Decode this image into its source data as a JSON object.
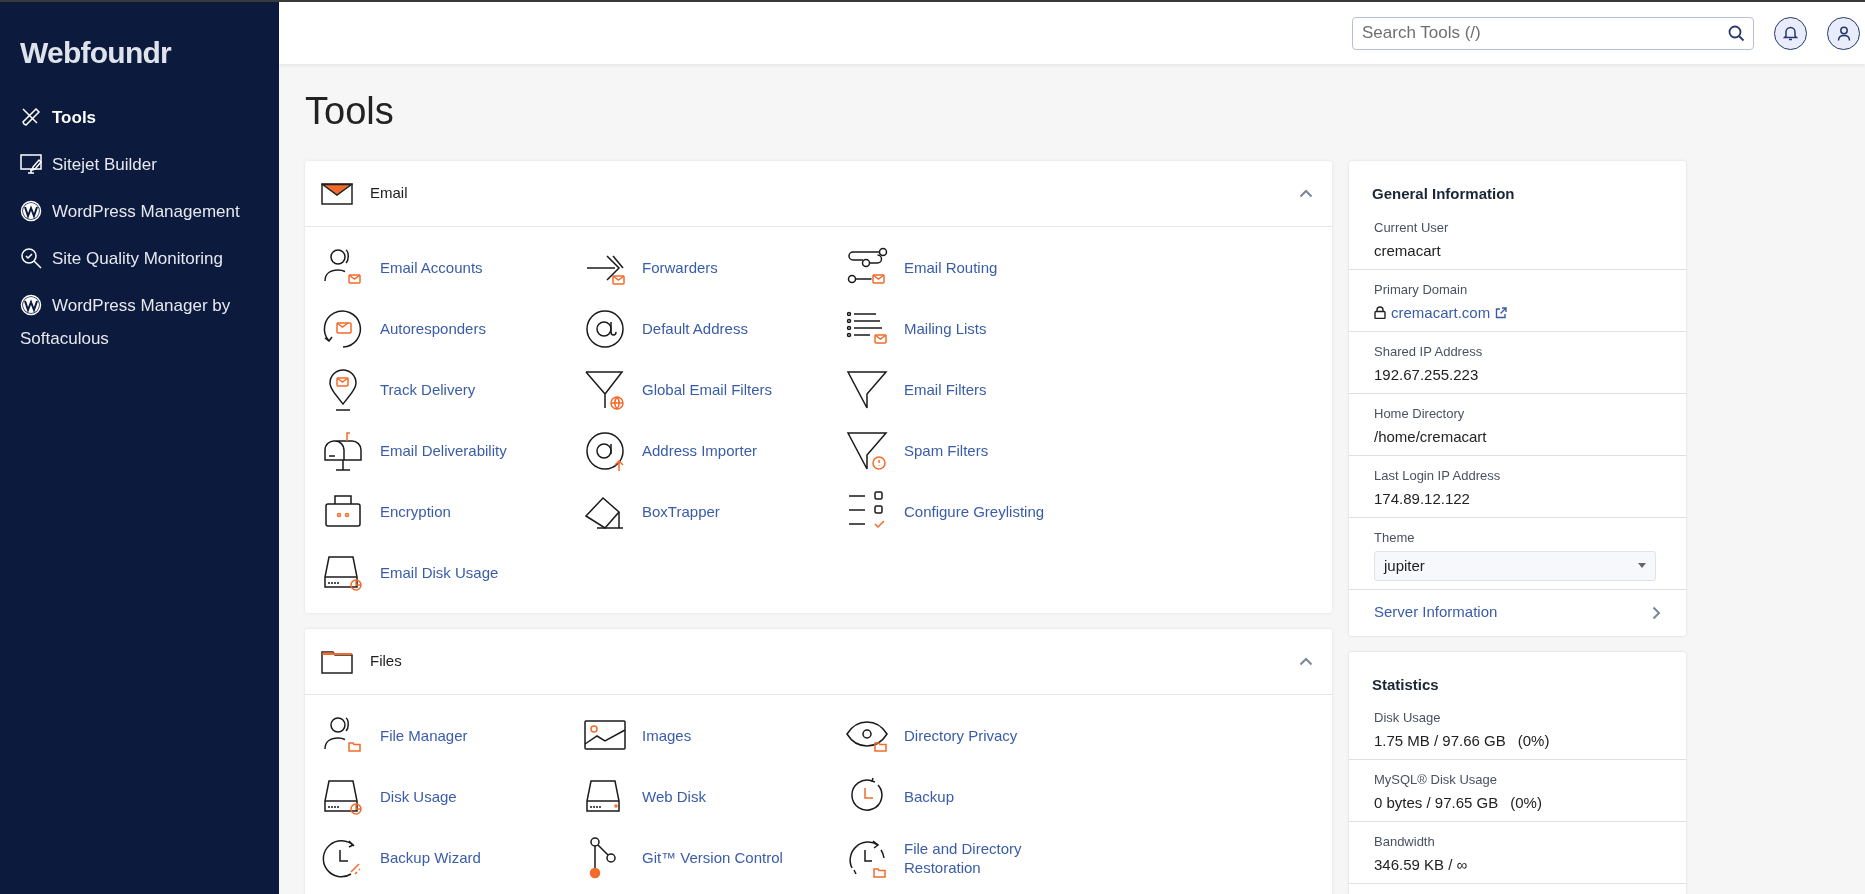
{
  "logo": "Webfoundr",
  "sidebar": {
    "items": [
      {
        "label": "Tools",
        "selected": true
      },
      {
        "label": "Sitejet Builder",
        "selected": false
      },
      {
        "label": "WordPress Management",
        "selected": false
      },
      {
        "label": "Site Quality Monitoring",
        "selected": false
      },
      {
        "label": "WordPress Manager by Softaculous",
        "selected": false
      }
    ]
  },
  "header": {
    "search": {
      "placeholder": "Search Tools (/)"
    }
  },
  "page_title": "Tools",
  "sections": [
    {
      "title": "Email",
      "expanded": true,
      "items": [
        {
          "label": "Email Accounts"
        },
        {
          "label": "Forwarders"
        },
        {
          "label": "Email Routing"
        },
        {
          "label": "Autoresponders"
        },
        {
          "label": "Default Address"
        },
        {
          "label": "Mailing Lists"
        },
        {
          "label": "Track Delivery"
        },
        {
          "label": "Global Email Filters"
        },
        {
          "label": "Email Filters"
        },
        {
          "label": "Email Deliverability"
        },
        {
          "label": "Address Importer"
        },
        {
          "label": "Spam Filters"
        },
        {
          "label": "Encryption"
        },
        {
          "label": "BoxTrapper"
        },
        {
          "label": "Configure Greylisting"
        },
        {
          "label": "Email Disk Usage"
        }
      ]
    },
    {
      "title": "Files",
      "expanded": true,
      "items": [
        {
          "label": "File Manager"
        },
        {
          "label": "Images"
        },
        {
          "label": "Directory Privacy"
        },
        {
          "label": "Disk Usage"
        },
        {
          "label": "Web Disk"
        },
        {
          "label": "Backup"
        },
        {
          "label": "Backup Wizard"
        },
        {
          "label": "Git™ Version Control"
        },
        {
          "label": "File and Directory Restoration"
        }
      ]
    }
  ],
  "general_information": {
    "title": "General Information",
    "fields": [
      {
        "kind": "text",
        "label": "Current User",
        "value": "cremacart"
      },
      {
        "kind": "link",
        "label": "Primary Domain",
        "value": "cremacart.com"
      },
      {
        "kind": "text",
        "label": "Shared IP Address",
        "value": "192.67.255.223"
      },
      {
        "kind": "text",
        "label": "Home Directory",
        "value": "/home/cremacart"
      },
      {
        "kind": "text",
        "label": "Last Login IP Address",
        "value": "174.89.12.122"
      },
      {
        "kind": "select",
        "label": "Theme",
        "value": "jupiter"
      }
    ],
    "link": "Server Information"
  },
  "statistics": {
    "title": "Statistics",
    "items": [
      {
        "label": "Disk Usage",
        "value": "1.75 MB / 97.66 GB",
        "percent": "(0%)"
      },
      {
        "label": "MySQL® Disk Usage",
        "value": "0 bytes / 97.65 GB",
        "percent": "(0%)"
      },
      {
        "label": "Bandwidth",
        "value": "346.59 KB / ∞"
      }
    ]
  }
}
